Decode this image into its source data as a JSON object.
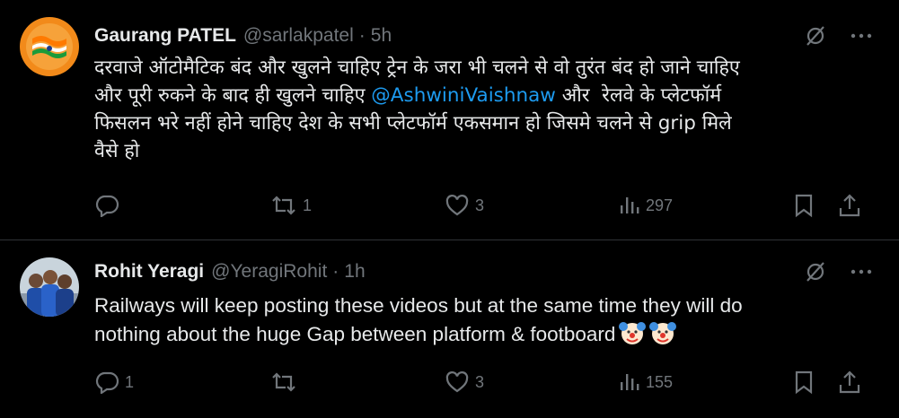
{
  "tweets": [
    {
      "name": "Gaurang PATEL",
      "handle": "@sarlakpatel",
      "separator": "·",
      "time": "5h",
      "avatar_caption": "Independence Day",
      "text_before_mention": "दरवाजे ऑटोमैटिक बंद और खुलने चाहिए ट्रेन के जरा भी चलने से वो तुरंत बंद हो जाने चाहिए\nऔर पूरी रुकने के बाद ही खुलने चाहिए ",
      "mention": "@AshwiniVaishnaw",
      "text_after_mention": " और  रेलवे के प्लेटफॉर्म\nफिसलन भरे नहीं होने चाहिए देश के सभी प्लेटफॉर्म एकसमान हो जिसमे चलने से grip मिले\nवैसे हो",
      "reply_count": "",
      "retweet_count": "1",
      "like_count": "3",
      "view_count": "297"
    },
    {
      "name": "Rohit Yeragi",
      "handle": "@YeragiRohit",
      "separator": "·",
      "time": "1h",
      "text": "Railways will keep posting these videos but at the same time they will do\nnothing about the huge Gap between platform & footboard",
      "emoji": "clown-face",
      "reply_count": "1",
      "retweet_count": "",
      "like_count": "3",
      "view_count": "155"
    }
  ],
  "icons": {
    "grok": "grok-slash-icon",
    "more": "more-dots-icon",
    "reply": "reply-icon",
    "retweet": "retweet-icon",
    "like": "heart-icon",
    "views": "views-icon",
    "bookmark": "bookmark-icon",
    "share": "share-icon"
  },
  "colors": {
    "background": "#000000",
    "text": "#e7e9ea",
    "secondary": "#71767b",
    "link": "#1d9bf0",
    "divider": "#2f3336"
  }
}
